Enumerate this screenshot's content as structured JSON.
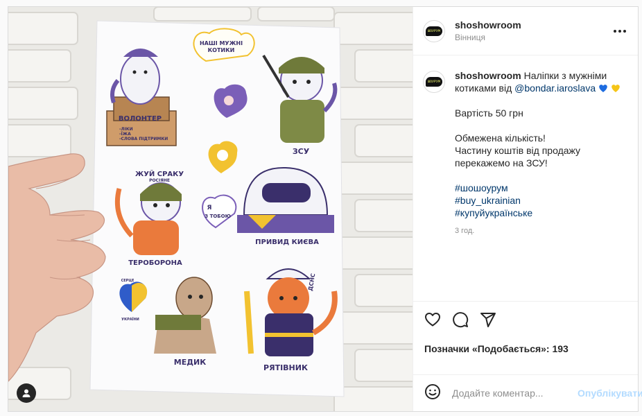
{
  "header": {
    "username": "shoshowroom",
    "location": "Вінниця"
  },
  "avatar_text": "ШОУРУМ",
  "caption": {
    "username": "shoshowroom",
    "text_start": "Наліпки з мужніми котиками від ",
    "mention": "@bondar.iaroslava",
    "price": "Вартість 50 грн",
    "limited_1": "Обмежена кількість!",
    "limited_2": "Частину коштів від продажу перекажемо на ЗСУ!",
    "hashtag_1": "#шошоурум",
    "hashtag_2": "#buy_ukrainian",
    "hashtag_3": "#купуйукраїнське",
    "time": "3 год."
  },
  "likes": "Позначки «Подобається»: 193",
  "comment": {
    "placeholder": "Додайте коментар...",
    "post_label": "Опублікувати"
  },
  "stickers": {
    "heart_title_1": "НАШІ МУЖНІ",
    "heart_title_2": "КОТИКИ",
    "volunteer": "ВОЛОНТЕР",
    "box_note_1": "-ЛІКИ",
    "box_note_2": "-ЇЖА",
    "box_note_3": "-СЛОВА ПІДТРИМКИ",
    "zsu": "ЗСУ",
    "slogan_1": "ЖУЙ СРАКУ",
    "slogan_2": "РОСІЯНЕ",
    "with_you_1": "Я",
    "with_you_2": "З ТОБОЮ",
    "ghost": "ПРИВИД КИЄВА",
    "teroborona": "ТЕРОБОРОНА",
    "dsns": "ДСНС",
    "heart_ua_1": "СЕРЦЕ",
    "heart_ua_2": "УКРАЇНИ",
    "medic": "МЕДИК",
    "rescuer": "РЯТІВНИК"
  },
  "colors": {
    "accent_link": "#00376b",
    "post_disabled": "#b3dbff",
    "sticker_purple": "#6b56a7",
    "sticker_yellow": "#f2c230",
    "sticker_olive": "#6f7a3a",
    "sticker_orange": "#ea7a3c"
  }
}
